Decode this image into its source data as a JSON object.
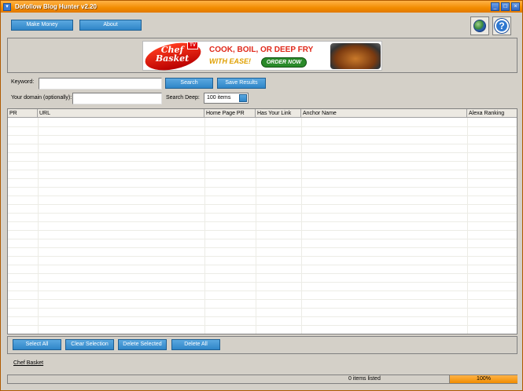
{
  "window": {
    "title": "Dofollow Blog Hunter v2.20"
  },
  "toolbar": {
    "make_money_label": "Make Money",
    "about_label": "About",
    "globe_icon": "globe-icon",
    "help_icon": "help-icon"
  },
  "banner": {
    "logo_line1": "Chef",
    "logo_line2": "Basket",
    "tv_badge": "TV",
    "headline": "COOK, BOIL, OR DEEP FRY",
    "subline": "WITH EASE!",
    "cta": "ORDER NOW"
  },
  "search": {
    "keyword_label": "Keyword:",
    "keyword_value": "",
    "search_button": "Search",
    "save_button": "Save Results",
    "domain_label": "Your domain (optionally):",
    "domain_value": "",
    "deep_label": "Search Deep:",
    "deep_value": "100 items"
  },
  "table": {
    "columns": [
      "PR",
      "URL",
      "Home Page PR",
      "Has Your Link",
      "Anchor Name",
      "Alexa Ranking"
    ],
    "rows": []
  },
  "actions": {
    "select_all": "Select All",
    "clear_selection": "Clear Selection",
    "delete_selected": "Delete Selected",
    "delete_all": "Delete All"
  },
  "footer": {
    "link_label": "Chef Basket"
  },
  "status": {
    "items_listed": "0 items listed",
    "progress_label": "100%",
    "progress_fraction": 1.0
  },
  "colors": {
    "title_bar": "#f28c00",
    "button_blue": "#2f86c8",
    "progress": "#f08c00"
  }
}
